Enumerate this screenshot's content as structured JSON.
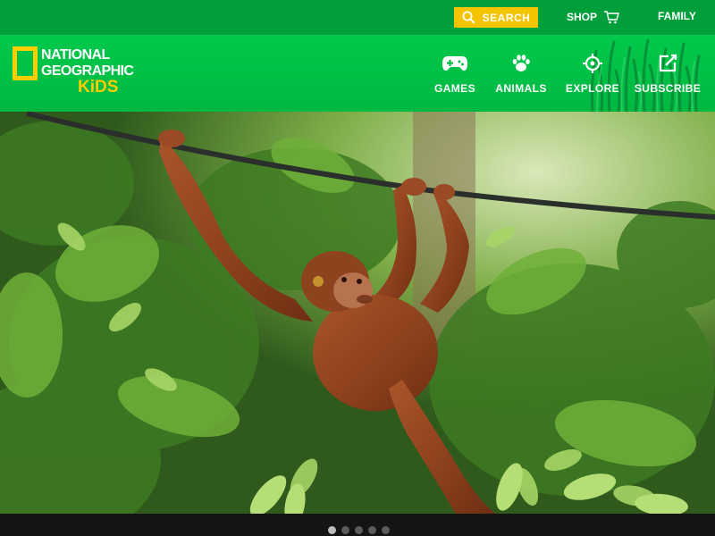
{
  "utility_bar": {
    "search_label": "SEARCH",
    "shop_label": "SHOP",
    "family_label": "FAMILY"
  },
  "logo": {
    "line1": "NATIONAL",
    "line2": "GEOGRAPHIC",
    "line3": "KiDS"
  },
  "nav": [
    {
      "label": "GAMES",
      "icon": "gamepad-icon"
    },
    {
      "label": "ANIMALS",
      "icon": "paw-icon"
    },
    {
      "label": "EXPLORE",
      "icon": "crosshair-icon"
    },
    {
      "label": "SUBSCRIBE",
      "icon": "edit-icon"
    }
  ],
  "hero": {
    "subject": "orangutan-hanging-from-rope"
  },
  "carousel": {
    "slide_count": 5,
    "active_index": 0
  },
  "colors": {
    "brand_green": "#00c94b",
    "top_green": "#009f3c",
    "accent_yellow": "#f5c400"
  }
}
